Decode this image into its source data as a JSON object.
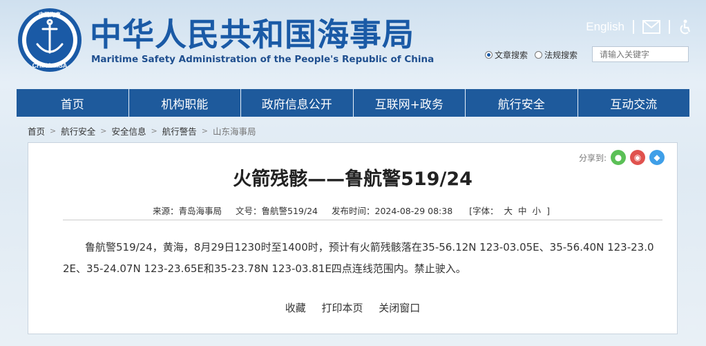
{
  "header": {
    "logo_text": "CHINA MSA",
    "logo_ring_text": "中国海事",
    "title_cn": "中华人民共和国海事局",
    "title_en": "Maritime Safety Administration of the People's Republic of China",
    "english_link": "English",
    "icons": [
      "mail-icon",
      "accessibility-icon"
    ]
  },
  "search": {
    "options": [
      "文章搜索",
      "法规搜索"
    ],
    "selected": "文章搜索",
    "placeholder": "请输入关键字"
  },
  "nav": [
    "首页",
    "机构职能",
    "政府信息公开",
    "互联网+政务",
    "航行安全",
    "互动交流"
  ],
  "breadcrumb": [
    "首页",
    "航行安全",
    "安全信息",
    "航行警告",
    "山东海事局"
  ],
  "share": {
    "label": "分享到:",
    "icons": [
      "wechat-icon",
      "weibo-icon",
      "qq-icon"
    ],
    "colors": [
      "#5bc056",
      "#e0524e",
      "#3f9fe8"
    ]
  },
  "article": {
    "title": "火箭残骸——鲁航警519/24",
    "source": "来源：青岛海事局",
    "doc_no": "文号：鲁航警519/24",
    "time": "发布时间：2024-08-29 08:38",
    "font_label": "[字体：",
    "font_sizes": [
      "大",
      "中",
      "小"
    ],
    "font_close": "]",
    "body": "鲁航警519/24，黄海，8月29日1230时至1400时，预计有火箭残骸落在35-56.12N 123-03.05E、35-56.40N 123-23.02E、35-24.07N 123-23.65E和35-23.78N 123-03.81E四点连线范围内。禁止驶入。"
  },
  "actions": [
    "收藏",
    "打印本页",
    "关闭窗口"
  ],
  "colors": {
    "nav_bg": "#1e5a9c",
    "brand_blue": "#1a5aa6"
  }
}
